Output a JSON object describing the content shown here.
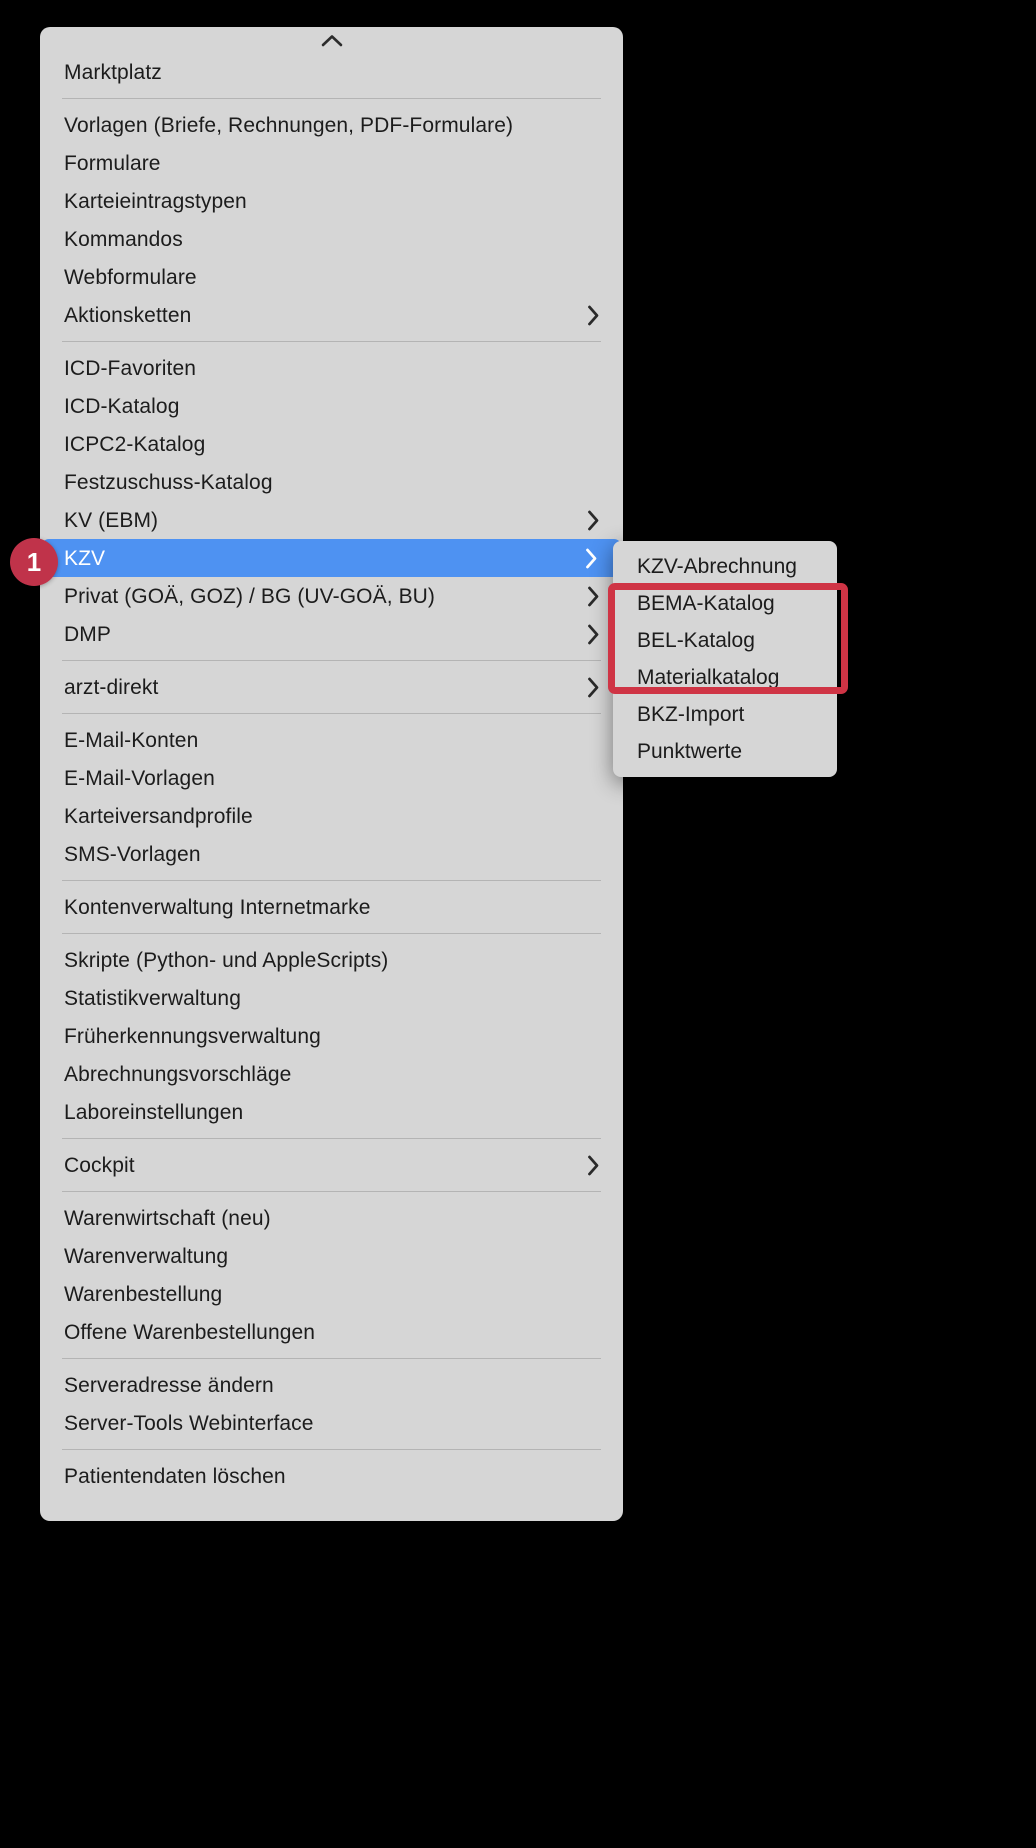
{
  "menu": {
    "scroll_up_icon": "chevron-up-icon",
    "sections": [
      {
        "items": [
          {
            "label": "Marktplatz",
            "has_submenu": false,
            "selected": false
          }
        ]
      },
      {
        "items": [
          {
            "label": "Vorlagen (Briefe, Rechnungen, PDF-Formulare)",
            "has_submenu": false,
            "selected": false
          },
          {
            "label": "Formulare",
            "has_submenu": false,
            "selected": false
          },
          {
            "label": "Karteieintragstypen",
            "has_submenu": false,
            "selected": false
          },
          {
            "label": "Kommandos",
            "has_submenu": false,
            "selected": false
          },
          {
            "label": "Webformulare",
            "has_submenu": false,
            "selected": false
          },
          {
            "label": "Aktionsketten",
            "has_submenu": true,
            "selected": false
          }
        ]
      },
      {
        "items": [
          {
            "label": "ICD-Favoriten",
            "has_submenu": false,
            "selected": false
          },
          {
            "label": "ICD-Katalog",
            "has_submenu": false,
            "selected": false
          },
          {
            "label": "ICPC2-Katalog",
            "has_submenu": false,
            "selected": false
          },
          {
            "label": "Festzuschuss-Katalog",
            "has_submenu": false,
            "selected": false
          },
          {
            "label": "KV (EBM)",
            "has_submenu": true,
            "selected": false
          },
          {
            "label": "KZV",
            "has_submenu": true,
            "selected": true
          },
          {
            "label": "Privat (GOÄ, GOZ) / BG (UV-GOÄ, BU)",
            "has_submenu": true,
            "selected": false
          },
          {
            "label": "DMP",
            "has_submenu": true,
            "selected": false
          }
        ]
      },
      {
        "items": [
          {
            "label": "arzt-direkt",
            "has_submenu": true,
            "selected": false
          }
        ]
      },
      {
        "items": [
          {
            "label": "E-Mail-Konten",
            "has_submenu": false,
            "selected": false
          },
          {
            "label": "E-Mail-Vorlagen",
            "has_submenu": false,
            "selected": false
          },
          {
            "label": "Karteiversandprofile",
            "has_submenu": false,
            "selected": false
          },
          {
            "label": "SMS-Vorlagen",
            "has_submenu": false,
            "selected": false
          }
        ]
      },
      {
        "items": [
          {
            "label": "Kontenverwaltung Internetmarke",
            "has_submenu": false,
            "selected": false
          }
        ]
      },
      {
        "items": [
          {
            "label": "Skripte (Python- und AppleScripts)",
            "has_submenu": false,
            "selected": false
          },
          {
            "label": "Statistikverwaltung",
            "has_submenu": false,
            "selected": false
          },
          {
            "label": "Früherkennungsverwaltung",
            "has_submenu": false,
            "selected": false
          },
          {
            "label": "Abrechnungsvorschläge",
            "has_submenu": false,
            "selected": false
          },
          {
            "label": "Laboreinstellungen",
            "has_submenu": false,
            "selected": false
          }
        ]
      },
      {
        "items": [
          {
            "label": "Cockpit",
            "has_submenu": true,
            "selected": false
          }
        ]
      },
      {
        "items": [
          {
            "label": "Warenwirtschaft (neu)",
            "has_submenu": false,
            "selected": false
          },
          {
            "label": "Warenverwaltung",
            "has_submenu": false,
            "selected": false
          },
          {
            "label": "Warenbestellung",
            "has_submenu": false,
            "selected": false
          },
          {
            "label": "Offene Warenbestellungen",
            "has_submenu": false,
            "selected": false
          }
        ]
      },
      {
        "items": [
          {
            "label": "Serveradresse ändern",
            "has_submenu": false,
            "selected": false
          },
          {
            "label": "Server-Tools Webinterface",
            "has_submenu": false,
            "selected": false
          }
        ]
      },
      {
        "items": [
          {
            "label": "Patientendaten löschen",
            "has_submenu": false,
            "selected": false
          }
        ]
      }
    ]
  },
  "submenu": {
    "parent_label": "KZV",
    "items": [
      {
        "label": "KZV-Abrechnung",
        "highlighted": false
      },
      {
        "label": "BEMA-Katalog",
        "highlighted": true
      },
      {
        "label": "BEL-Katalog",
        "highlighted": true
      },
      {
        "label": "Materialkatalog",
        "highlighted": true
      },
      {
        "label": "BKZ-Import",
        "highlighted": false
      },
      {
        "label": "Punktwerte",
        "highlighted": false
      }
    ]
  },
  "annotation": {
    "badge_number": "1",
    "badge_color": "#c0334a",
    "box_color": "#cf3445"
  },
  "colors": {
    "menu_background": "#d6d6d6",
    "selection_blue": "#4e92f2",
    "text": "#1c1c1c",
    "separator": "#b4b4b4",
    "page_background": "#000000"
  }
}
